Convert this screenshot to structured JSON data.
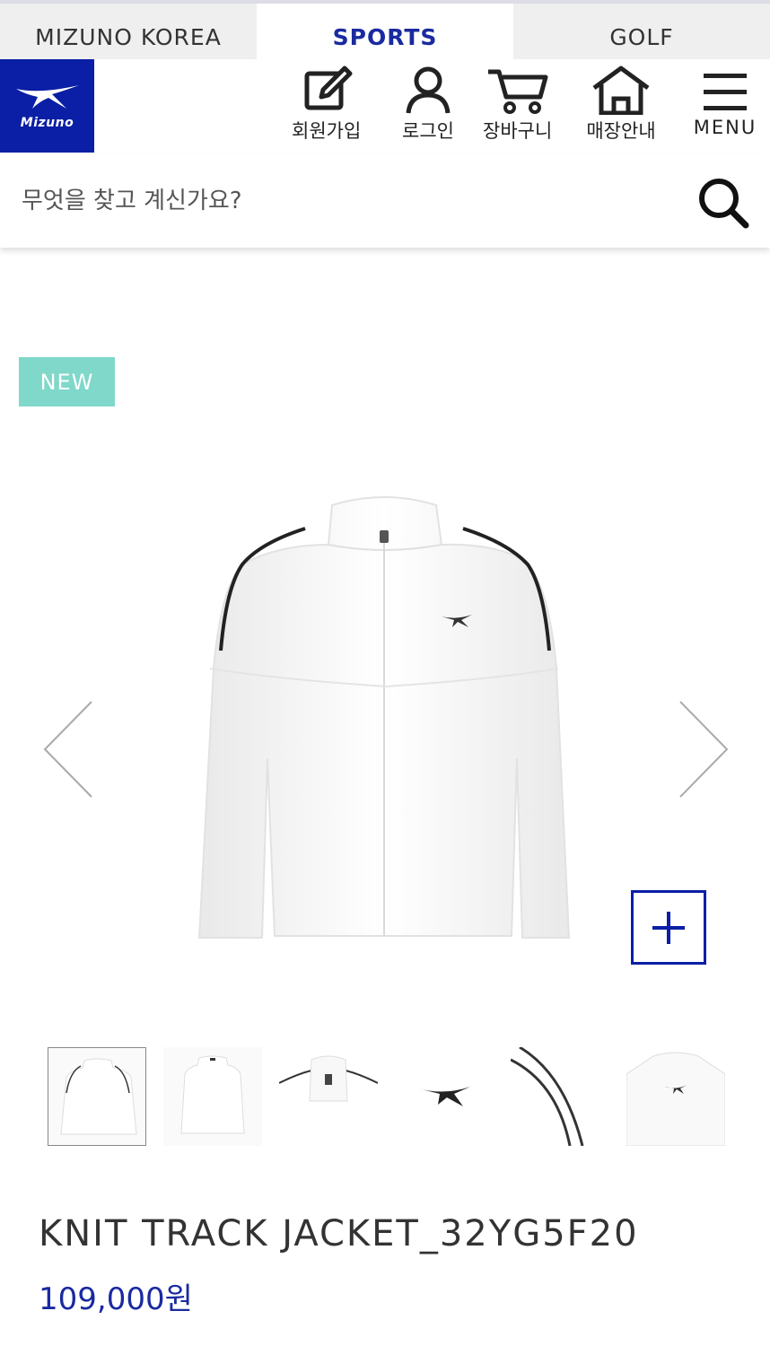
{
  "tabs": [
    {
      "label": "MIZUNO KOREA"
    },
    {
      "label": "SPORTS",
      "active": true
    },
    {
      "label": "GOLF"
    }
  ],
  "logo": {
    "text": "Mizuno",
    "color": "#0a1fa5"
  },
  "nav": {
    "signup": {
      "label": "회원가입",
      "icon": "edit-icon"
    },
    "login": {
      "label": "로그인",
      "icon": "user-icon"
    },
    "cart": {
      "label": "장바구니",
      "icon": "cart-icon"
    },
    "stores": {
      "label": "매장안내",
      "icon": "home-icon"
    },
    "menu": {
      "label": "MENU",
      "icon": "hamburger-icon"
    }
  },
  "search": {
    "placeholder": "무엇을 찾고 계신가요?"
  },
  "product": {
    "badge": "NEW",
    "name": "KNIT TRACK JACKET_32YG5F20",
    "price": "109,000원",
    "thumbnail_count": 6,
    "selected_thumbnail": 1
  },
  "colors": {
    "brand": "#0a1fa5",
    "badge": "#7fd8c9",
    "price": "#1a2aa0"
  }
}
